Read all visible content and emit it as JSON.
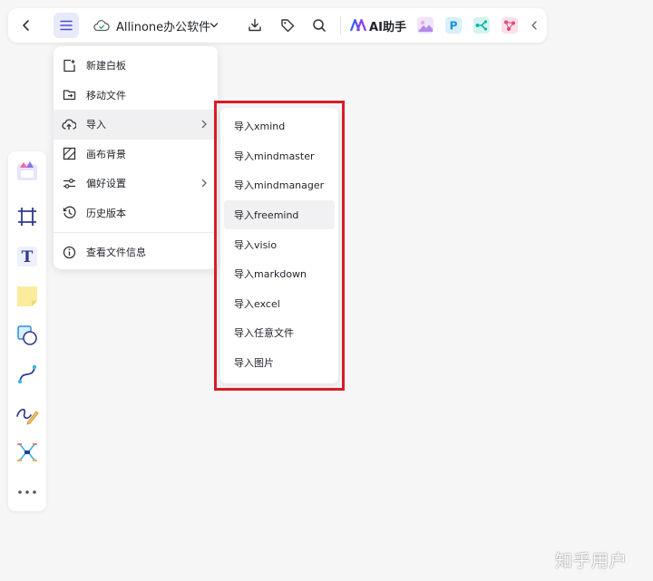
{
  "toolbar": {
    "file_title": "Allinone办公软件",
    "ai_label": "AI助手",
    "app_icons": [
      "image-ai-app",
      "p-app",
      "flow-app",
      "mindmap-app"
    ],
    "menu_active_bg": "#e9eaf9"
  },
  "main_menu": {
    "items": [
      {
        "label": "新建白板",
        "icon": "new-whiteboard-icon"
      },
      {
        "label": "移动文件",
        "icon": "move-folder-icon"
      },
      {
        "label": "导入",
        "icon": "cloud-upload-icon",
        "has_submenu": true,
        "active": true
      },
      {
        "label": "画布背景",
        "icon": "canvas-background-icon"
      },
      {
        "label": "偏好设置",
        "icon": "sliders-icon",
        "has_submenu": true
      },
      {
        "label": "历史版本",
        "icon": "history-icon"
      },
      {
        "label": "查看文件信息",
        "icon": "info-icon"
      }
    ]
  },
  "import_submenu": {
    "items": [
      "导入xmind",
      "导入mindmaster",
      "导入mindmanager",
      "导入freemind",
      "导入visio",
      "导入markdown",
      "导入excel",
      "导入任意文件",
      "导入图片"
    ],
    "hovered_index": 3,
    "highlight_color": "#d81e27"
  },
  "left_rail": {
    "tools": [
      "template-icon",
      "frame-icon",
      "text-icon",
      "sticky-note-icon",
      "shape-icon",
      "connector-icon",
      "pen-icon",
      "mindmap-icon",
      "more-icon"
    ]
  },
  "watermark": "知乎用户"
}
